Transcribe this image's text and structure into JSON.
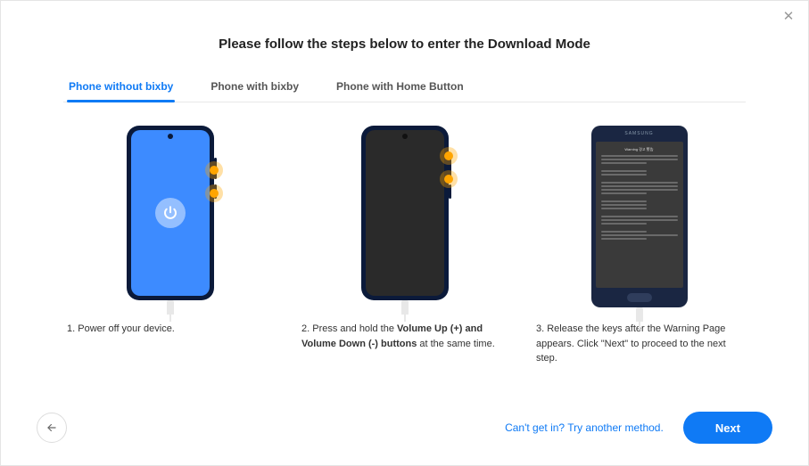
{
  "title": "Please follow the steps below to enter the Download Mode",
  "tabs": [
    {
      "label": "Phone without bixby",
      "active": true
    },
    {
      "label": "Phone with bixby",
      "active": false
    },
    {
      "label": "Phone with Home Button",
      "active": false
    }
  ],
  "steps": {
    "s1": {
      "prefix": "1. ",
      "text": "Power off your device."
    },
    "s2": {
      "prefix": "2. ",
      "before": "Press and hold the ",
      "bold": "Volume Up (+) and Volume Down (-) buttons",
      "after": " at the same time."
    },
    "s3": {
      "prefix": "3. ",
      "text": "Release the keys after the Warning Page appears. Click \"Next\" to proceed to the next step."
    }
  },
  "phone3": {
    "brand": "SAMSUNG",
    "warning_title": "Warning 경고 警告"
  },
  "footer": {
    "link": "Can't get in? Try another method.",
    "next": "Next"
  }
}
